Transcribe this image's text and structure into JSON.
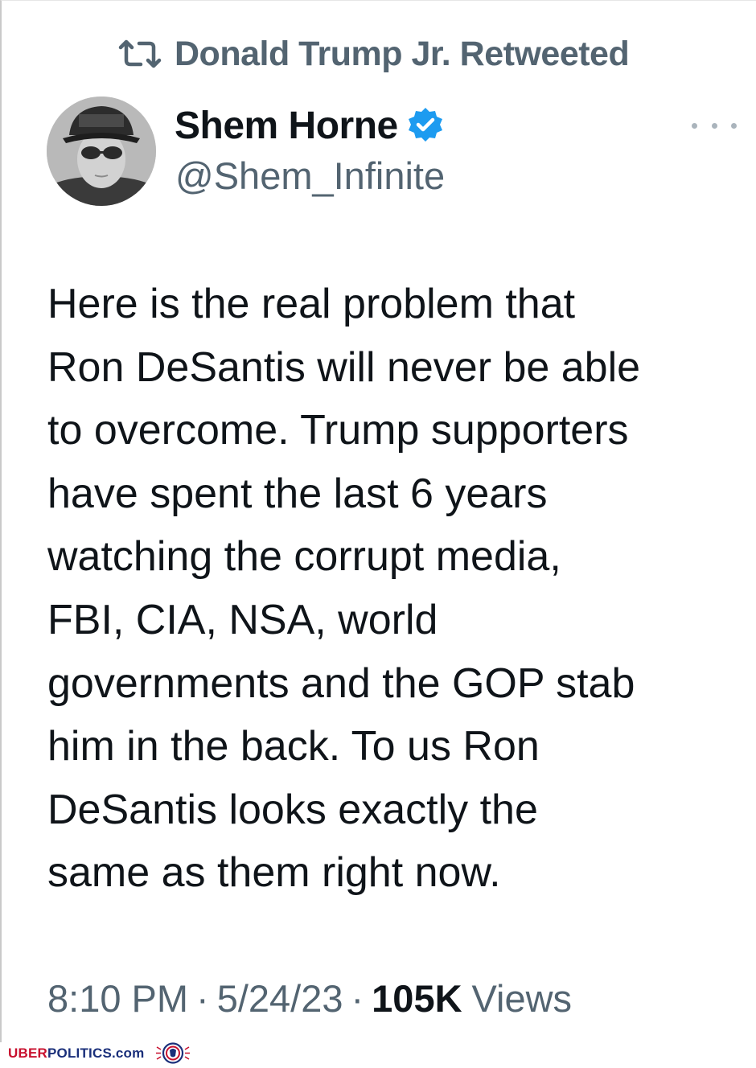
{
  "retweet": {
    "icon": "retweet-icon",
    "text": "Donald Trump Jr. Retweeted"
  },
  "author": {
    "name": "Shem Horne",
    "handle": "@Shem_Infinite",
    "verified_icon": "verified-badge-icon",
    "verified_color": "#1d9bf0"
  },
  "tweet": {
    "lines": [
      "Here is the real problem that",
      "Ron DeSantis will never be able",
      "to overcome. Trump supporters",
      "have spent the last 6 years",
      "watching the corrupt media,",
      "FBI, CIA, NSA, world",
      "governments and the GOP stab",
      "him in the back. To us Ron",
      "DeSantis looks exactly the",
      "same as them right now."
    ]
  },
  "meta": {
    "time": "8:10 PM",
    "separator": "·",
    "date": "5/24/23",
    "views_count": "105K",
    "views_label": "Views"
  },
  "watermark": {
    "part1": "UBER",
    "part2": "POLITICS.com",
    "part1_color": "#c8102e",
    "part2_color": "#1a2f7a"
  },
  "colors": {
    "text_primary": "#0f1419",
    "text_secondary": "#536471",
    "background": "#ffffff"
  }
}
